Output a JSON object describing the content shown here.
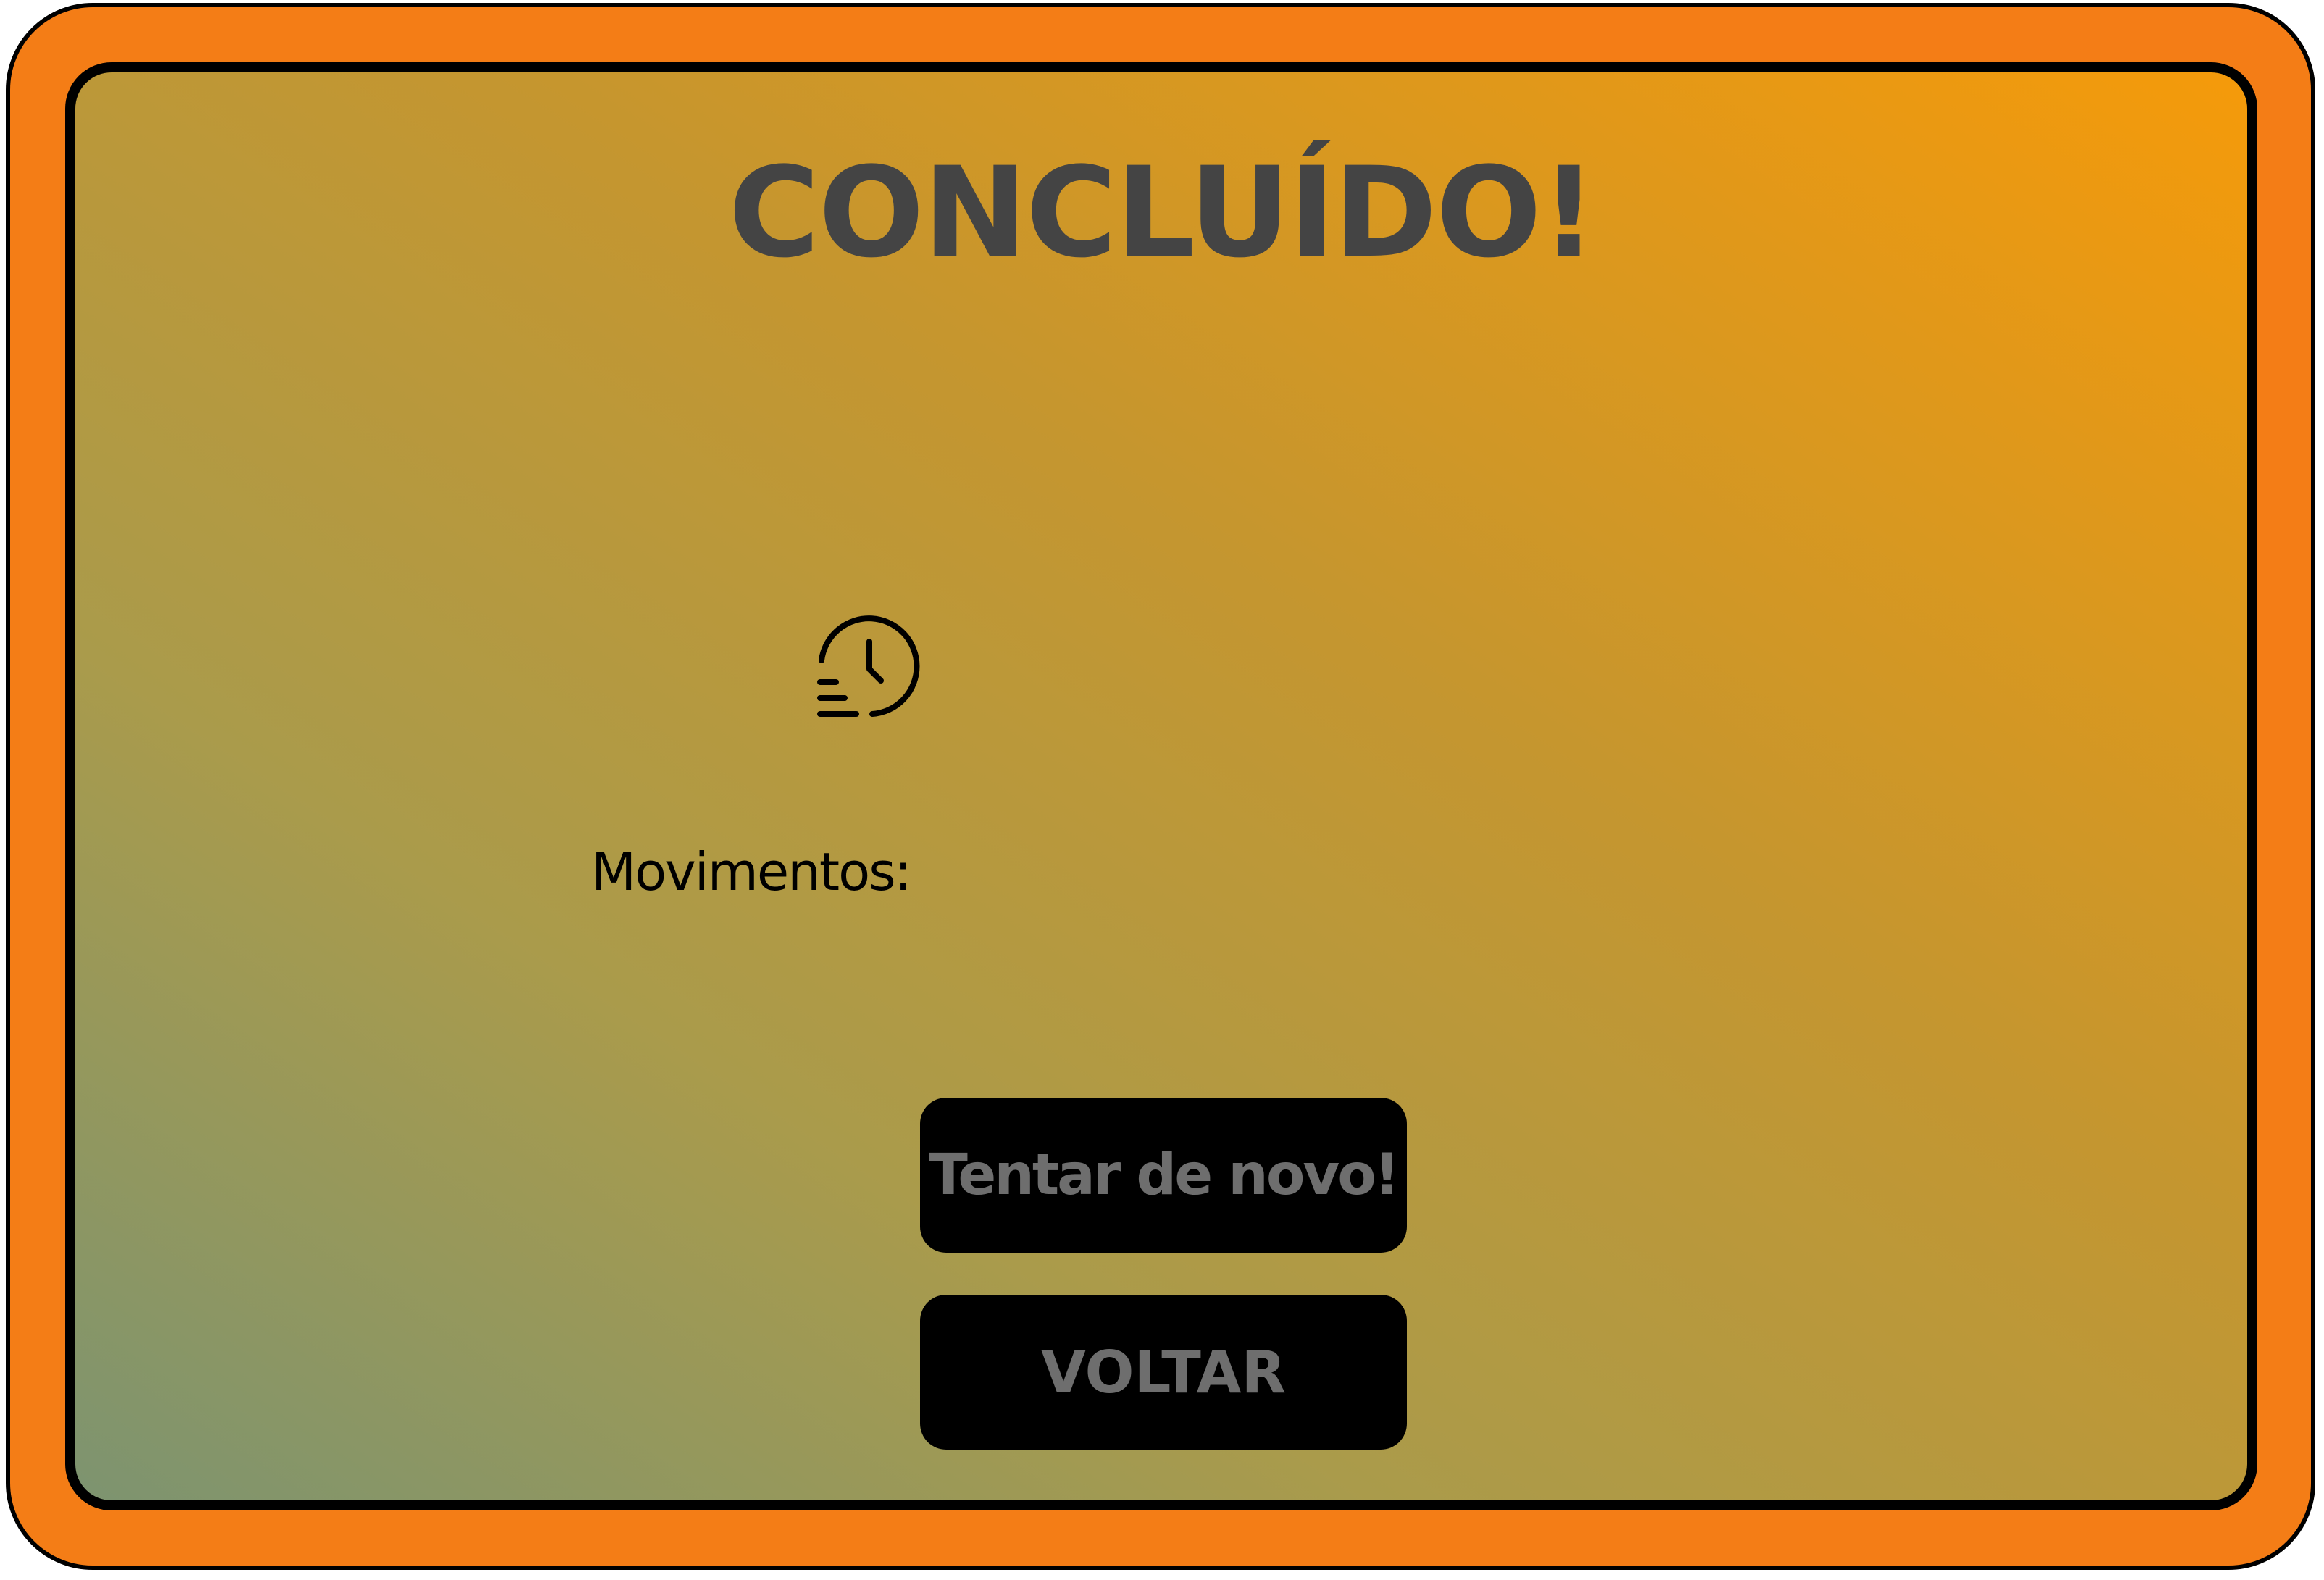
{
  "screen": {
    "title": "CONCLUÍDO!",
    "moves_label": "Movimentos:",
    "history_icon": "history-clock-icon"
  },
  "actions": {
    "retry_label": "Tentar de novo!",
    "back_label": "VOLTAR"
  },
  "colors": {
    "frame": "#f47d16",
    "panel_gradient": [
      "#7d9470",
      "#aa9b4b",
      "#c5962f",
      "#f59a0a"
    ],
    "title": "#444444",
    "button_bg": "#000000",
    "button_text": "#6e6e6e"
  }
}
